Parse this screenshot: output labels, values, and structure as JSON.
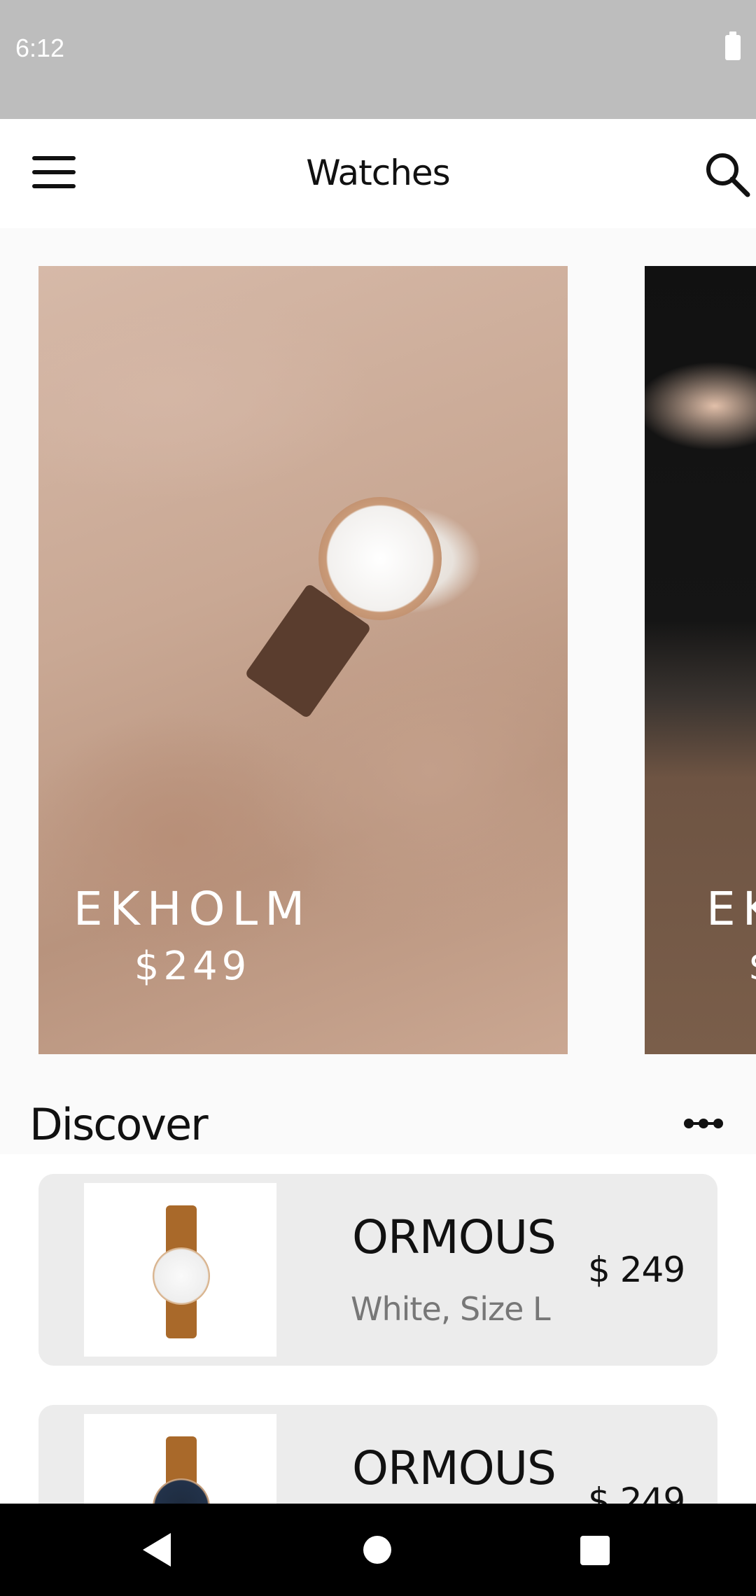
{
  "status_bar": {
    "time": "6:12"
  },
  "app_bar": {
    "title": "Watches",
    "menu_icon": "menu-icon",
    "search_icon": "search-icon"
  },
  "carousel": {
    "cards": [
      {
        "name": "EKHOLM",
        "price": "$249"
      },
      {
        "name": "EK",
        "price": "$"
      }
    ]
  },
  "discover": {
    "title": "Discover",
    "more_icon": "more-horizontal-icon",
    "items": [
      {
        "name": "ORMOUS",
        "subtitle": "White, Size L",
        "price": "$ 249"
      },
      {
        "name": "ORMOUS",
        "subtitle": "",
        "price": "$ 249"
      }
    ]
  },
  "nav_bar": {
    "back_icon": "back-icon",
    "home_icon": "home-icon",
    "recents_icon": "recents-icon"
  },
  "colors": {
    "status_bar": "#bdbdbd",
    "background": "#fafafa",
    "card_bg": "#ececec",
    "nav_bar": "#000000"
  }
}
